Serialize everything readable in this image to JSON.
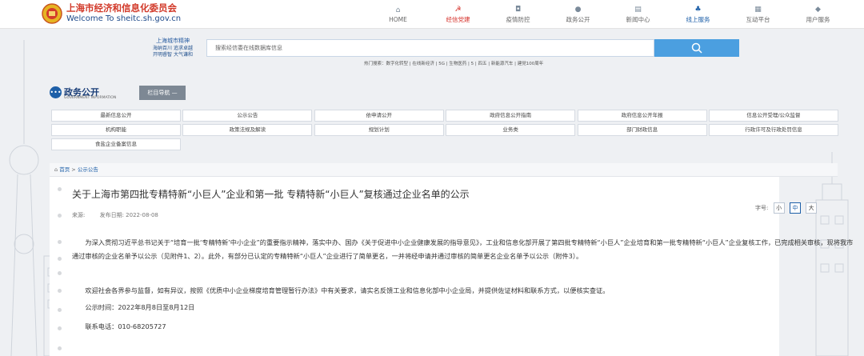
{
  "header": {
    "brand_cn": "上海市经济和信息化委员会",
    "brand_en": "Welcome To sheitc.sh.gov.cn",
    "nav": [
      {
        "icon": "home-icon",
        "glyph": "⌂",
        "label": "HOME",
        "color": "default"
      },
      {
        "icon": "party-icon",
        "glyph": "☭",
        "label": "经信党建",
        "color": "red"
      },
      {
        "icon": "shield-icon",
        "glyph": "◘",
        "label": "疫情防控",
        "color": "default"
      },
      {
        "icon": "chat-icon",
        "glyph": "●",
        "label": "政务公开",
        "color": "default"
      },
      {
        "icon": "news-icon",
        "glyph": "▤",
        "label": "新闻中心",
        "color": "default"
      },
      {
        "icon": "service-icon",
        "glyph": "♣",
        "label": "线上服务",
        "color": "blue"
      },
      {
        "icon": "interact-icon",
        "glyph": "▦",
        "label": "互动平台",
        "color": "default"
      },
      {
        "icon": "user-icon",
        "glyph": "◆",
        "label": "用户服务",
        "color": "default"
      }
    ]
  },
  "search": {
    "label_top": "上海城市精神",
    "label_line1": "海纳百川 追求卓越",
    "label_line2": "开明睿智 大气谦和",
    "placeholder": "搜索经信委在线数据库信息",
    "hot": "热门搜索：数字化转型 | 在线新经济 | 5G | 生物医药 | 5 | 四五 | 新能源汽车 | 建党100周年"
  },
  "section": {
    "title": "政务公开",
    "subtitle": "GOVERNMENT INFORMATION",
    "nav_button": "栏目导航 —"
  },
  "categories": [
    "最新信息公开",
    "公示公告",
    "依申请公开",
    "政府信息公开指南",
    "政府信息公开年报",
    "信息公开受理/公众监督",
    "机构职能",
    "政策法规及解读",
    "规划计划",
    "业务类",
    "部门财政信息",
    "行政许可及行政处罚信息",
    "食盐企业备案信息"
  ],
  "breadcrumb": {
    "home": "首页",
    "sep": ">",
    "current": "公示公告"
  },
  "article": {
    "title": "关于上海市第四批专精特新“小巨人”企业和第一批 专精特新“小巨人”复核通过企业名单的公示",
    "source_label": "来源:",
    "date_label": "发布日期: 2022-08-08",
    "fontsize_label": "字号:",
    "fontsize_small": "小",
    "fontsize_medium": "中",
    "fontsize_large": "大",
    "p1": "为深入贯彻习近平总书记关于“培育一批‘专精特新’中小企业”的重要指示精神，落实中办、国办《关于促进中小企业健康发展的指导意见》，工业和信息化部开展了第四批专精特新“小巨人”企业培育和第一批专精特新“小巨人”企业复核工作，已完成相关审核，现将我市通过审核的企业名单予以公示（见附件1、2）。此外，有部分已认定的专精特新“小巨人”企业进行了简单更名，一并将经申请并通过审核的简单更名企业名单予以公示（附件3）。",
    "p2": "欢迎社会各界参与监督，如有异议，按照《优质中小企业梯度培育管理暂行办法》中有关要求，请实名反馈工业和信息化部中小企业局，并提供佐证材料和联系方式，以便核实查证。",
    "p3": "公示时间：2022年8月8日至8月12日",
    "p4": "联系电话：010-68205727"
  },
  "colors": {
    "accent": "#1d5fa8",
    "search_button": "#4b9fe0",
    "party_red": "#d6322b"
  }
}
